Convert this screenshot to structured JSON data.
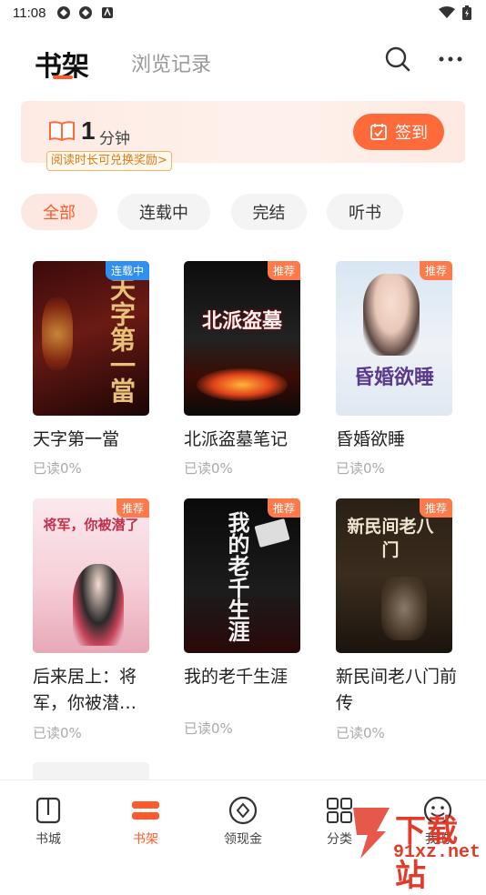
{
  "status_bar": {
    "time": "11:08"
  },
  "header": {
    "tab_active": "书架",
    "tab_inactive": "浏览记录"
  },
  "banner": {
    "minutes": "1",
    "unit": "分钟",
    "reward_text": "阅读时长可兑换奖励>",
    "checkin_label": "签到"
  },
  "filters": [
    "全部",
    "连载中",
    "完结",
    "听书"
  ],
  "books": [
    {
      "name": "天字第一當",
      "badge": "连载中",
      "cover_text": "天字第一當",
      "progress": "已读0%"
    },
    {
      "name": "北派盗墓笔记",
      "badge": "推荐",
      "cover_text": "北派盗墓",
      "progress": "已读0%"
    },
    {
      "name": "昏婚欲睡",
      "badge": "推荐",
      "cover_text": "昏婚欲睡",
      "progress": "已读0%"
    },
    {
      "name": "后来居上：将军，你被潜…",
      "badge": "推荐",
      "cover_text": "将军，你被潜了",
      "progress": "已读0%"
    },
    {
      "name": "我的老千生涯",
      "badge": "推荐",
      "cover_text": "我的老千生涯",
      "progress": "已读0%"
    },
    {
      "name": "新民间老八门前传",
      "badge": "推荐",
      "cover_text": "新民间老八门",
      "progress": "已读0%"
    }
  ],
  "bottom_nav": [
    "书城",
    "书架",
    "领现金",
    "分类",
    "我的"
  ],
  "watermark": {
    "text": "下载站",
    "sub": "91xz.net"
  },
  "colors": {
    "accent": "#ff5a2a",
    "badge_orange": "#ff7a4a",
    "badge_blue": "#2f8ff2"
  }
}
